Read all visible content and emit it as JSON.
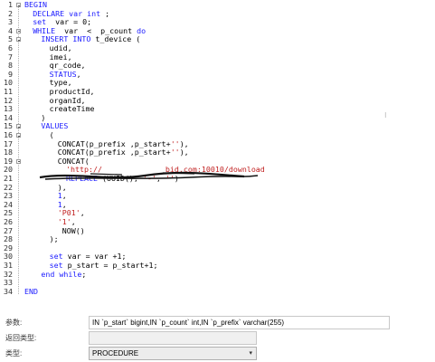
{
  "editor": {
    "lines": [
      {
        "n": "1",
        "fold": true,
        "indent": 0,
        "parts": [
          [
            "BEGIN",
            "kw"
          ]
        ]
      },
      {
        "n": "2",
        "fold": false,
        "indent": 1,
        "parts": [
          [
            "DECLARE var ",
            "kw"
          ],
          [
            "int",
            "kw"
          ],
          [
            " ;",
            ""
          ]
        ]
      },
      {
        "n": "3",
        "fold": false,
        "indent": 1,
        "parts": [
          [
            "set",
            "kw"
          ],
          [
            "  var = 0;",
            ""
          ]
        ]
      },
      {
        "n": "4",
        "fold": true,
        "indent": 1,
        "parts": [
          [
            "WHILE",
            "kw"
          ],
          [
            "  var  <  p_count ",
            ""
          ],
          [
            "do",
            "kw"
          ]
        ]
      },
      {
        "n": "5",
        "fold": true,
        "indent": 2,
        "parts": [
          [
            "INSERT INTO",
            "kw"
          ],
          [
            " t_device (",
            ""
          ]
        ]
      },
      {
        "n": "6",
        "fold": false,
        "indent": 3,
        "parts": [
          [
            "udid,",
            ""
          ]
        ]
      },
      {
        "n": "7",
        "fold": false,
        "indent": 3,
        "parts": [
          [
            "imei,",
            ""
          ]
        ]
      },
      {
        "n": "8",
        "fold": false,
        "indent": 3,
        "parts": [
          [
            "qr_code,",
            ""
          ]
        ]
      },
      {
        "n": "9",
        "fold": false,
        "indent": 3,
        "parts": [
          [
            "STATUS",
            "kw"
          ],
          [
            ",",
            ""
          ]
        ]
      },
      {
        "n": "10",
        "fold": false,
        "indent": 3,
        "parts": [
          [
            "type,",
            ""
          ]
        ]
      },
      {
        "n": "11",
        "fold": false,
        "indent": 3,
        "parts": [
          [
            "productId,",
            ""
          ]
        ]
      },
      {
        "n": "12",
        "fold": false,
        "indent": 3,
        "parts": [
          [
            "organId,",
            ""
          ]
        ]
      },
      {
        "n": "13",
        "fold": false,
        "indent": 3,
        "parts": [
          [
            "createTime",
            ""
          ]
        ]
      },
      {
        "n": "14",
        "fold": false,
        "indent": 2,
        "parts": [
          [
            ")",
            ""
          ]
        ]
      },
      {
        "n": "15",
        "fold": true,
        "indent": 2,
        "parts": [
          [
            "VALUES",
            "kw"
          ]
        ]
      },
      {
        "n": "16",
        "fold": true,
        "indent": 3,
        "parts": [
          [
            "(",
            ""
          ]
        ]
      },
      {
        "n": "17",
        "fold": false,
        "indent": 4,
        "parts": [
          [
            "CONCAT(p_prefix ,p_start+",
            ""
          ],
          [
            "''",
            "str"
          ],
          [
            "),",
            ""
          ]
        ]
      },
      {
        "n": "18",
        "fold": false,
        "indent": 4,
        "parts": [
          [
            "CONCAT(p_prefix ,p_start+",
            ""
          ],
          [
            "''",
            "str"
          ],
          [
            "),",
            ""
          ]
        ]
      },
      {
        "n": "19",
        "fold": true,
        "indent": 4,
        "parts": [
          [
            "CONCAT(",
            ""
          ]
        ]
      },
      {
        "n": "20",
        "fold": false,
        "indent": 5,
        "parts": [
          [
            "'http://",
            "str"
          ],
          [
            "              ",
            ""
          ],
          [
            "bid.com:10010/download",
            "str"
          ]
        ]
      },
      {
        "n": "21",
        "fold": false,
        "indent": 5,
        "parts": [
          [
            "REPLACE",
            "kw"
          ],
          [
            " (UUID(), ",
            ""
          ],
          [
            "'-'",
            "str"
          ],
          [
            ", ",
            ""
          ],
          [
            "''",
            "str"
          ],
          [
            ")",
            ""
          ]
        ]
      },
      {
        "n": "22",
        "fold": false,
        "indent": 4,
        "parts": [
          [
            "),",
            ""
          ]
        ]
      },
      {
        "n": "23",
        "fold": false,
        "indent": 4,
        "parts": [
          [
            "1",
            "kw"
          ],
          [
            ",",
            ""
          ]
        ]
      },
      {
        "n": "24",
        "fold": false,
        "indent": 4,
        "parts": [
          [
            "1",
            "kw"
          ],
          [
            ",",
            ""
          ]
        ]
      },
      {
        "n": "25",
        "fold": false,
        "indent": 4,
        "parts": [
          [
            "'P01'",
            "str"
          ],
          [
            ",",
            ""
          ]
        ]
      },
      {
        "n": "26",
        "fold": false,
        "indent": 4,
        "parts": [
          [
            "'1'",
            "str"
          ],
          [
            ",",
            ""
          ]
        ]
      },
      {
        "n": "27",
        "fold": false,
        "indent": 4,
        "parts": [
          [
            " NOW()",
            ""
          ]
        ]
      },
      {
        "n": "28",
        "fold": false,
        "indent": 3,
        "parts": [
          [
            ");",
            ""
          ]
        ]
      },
      {
        "n": "29",
        "fold": false,
        "indent": 0,
        "parts": [
          [
            "",
            ""
          ]
        ]
      },
      {
        "n": "30",
        "fold": false,
        "indent": 3,
        "parts": [
          [
            "set",
            "kw"
          ],
          [
            " var = var +1;",
            ""
          ]
        ]
      },
      {
        "n": "31",
        "fold": false,
        "indent": 3,
        "parts": [
          [
            "set",
            "kw"
          ],
          [
            " p_start = p_start+1;",
            ""
          ]
        ]
      },
      {
        "n": "32",
        "fold": false,
        "indent": 2,
        "parts": [
          [
            "end while",
            "kw"
          ],
          [
            ";",
            ""
          ]
        ]
      },
      {
        "n": "33",
        "fold": false,
        "indent": 0,
        "parts": [
          [
            "",
            ""
          ]
        ]
      },
      {
        "n": "34",
        "fold": false,
        "indent": 0,
        "parts": [
          [
            "END",
            "kw"
          ]
        ]
      }
    ],
    "colors": {
      "keyword": "#1a1aff",
      "string": "#c01f1f",
      "text": "#000000"
    }
  },
  "props": {
    "params_label": "参数:",
    "params_value": "IN `p_start` bigint,IN `p_count` int,IN `p_prefix` varchar(255)",
    "return_label": "返回类型:",
    "return_value": "",
    "type_label": "类型:",
    "type_value": "PROCEDURE",
    "type_arrow_icon": "chevron-down-icon"
  }
}
